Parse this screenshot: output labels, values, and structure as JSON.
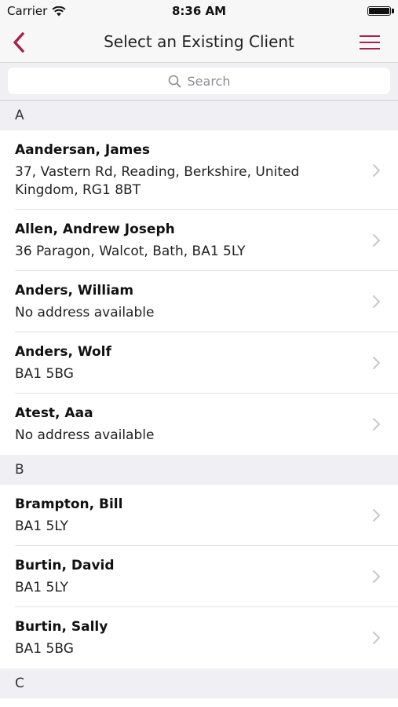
{
  "status_bar": {
    "carrier": "Carrier",
    "time": "8:36 AM",
    "battery_level": 1.0
  },
  "nav": {
    "title": "Select an Existing Client",
    "back_icon": "chevron-left-icon",
    "menu_icon": "hamburger-menu-icon"
  },
  "search": {
    "placeholder": "Search"
  },
  "colors": {
    "accent": "#a3234f",
    "section_bg": "#efeff4"
  },
  "sections": [
    {
      "letter": "A",
      "clients": [
        {
          "name": "Aandersan, James",
          "address": "37, Vastern Rd, Reading, Berkshire, United Kingdom, RG1 8BT"
        },
        {
          "name": "Allen, Andrew Joseph",
          "address": "36 Paragon, Walcot, Bath, BA1 5LY"
        },
        {
          "name": "Anders, William",
          "address": "No address available"
        },
        {
          "name": "Anders, Wolf",
          "address": "BA1 5BG"
        },
        {
          "name": "Atest, Aaa",
          "address": "No address available"
        }
      ]
    },
    {
      "letter": "B",
      "clients": [
        {
          "name": "Brampton, Bill",
          "address": "BA1 5LY"
        },
        {
          "name": "Burtin, David",
          "address": "BA1 5LY"
        },
        {
          "name": "Burtin, Sally",
          "address": "BA1 5BG"
        }
      ]
    },
    {
      "letter": "C",
      "clients": []
    }
  ]
}
